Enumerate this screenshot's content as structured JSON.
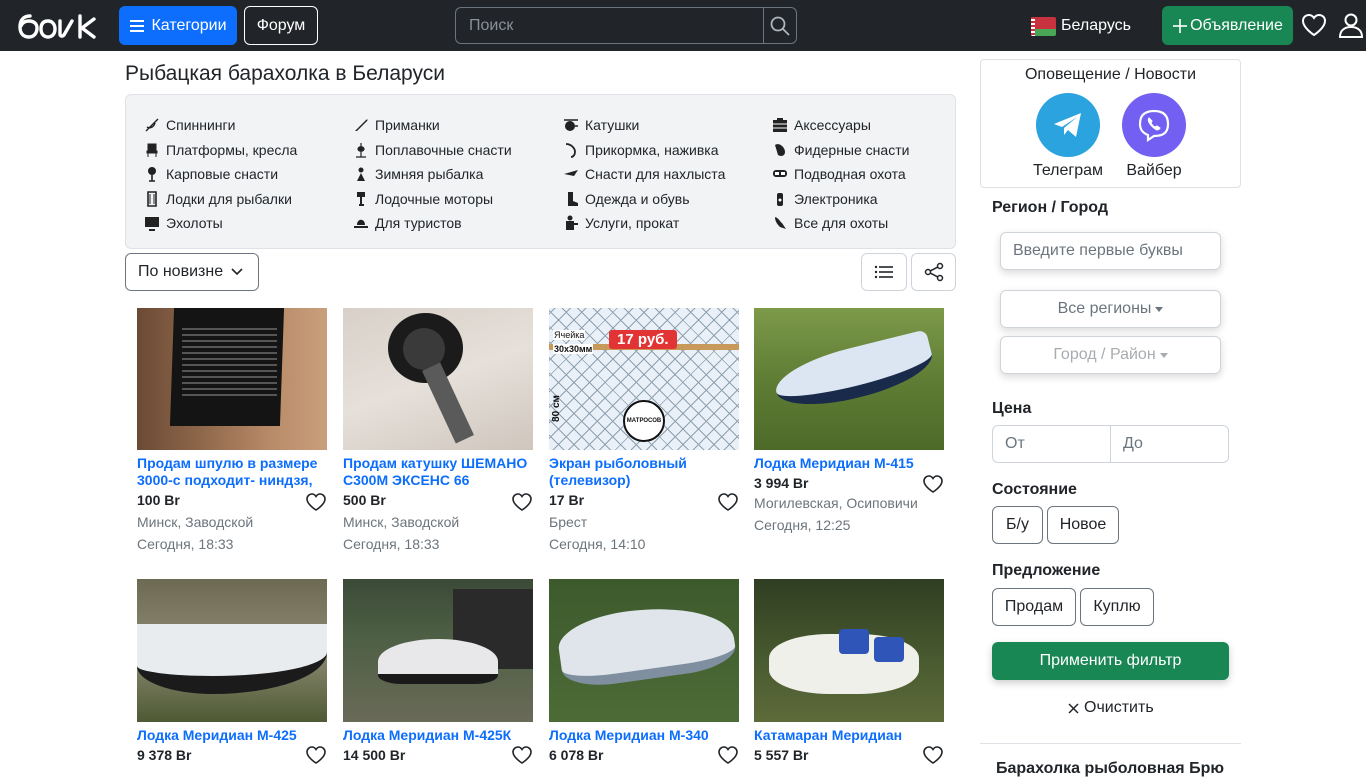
{
  "header": {
    "categories_label": "Категории",
    "forum_label": "Форум",
    "search_placeholder": "Поиск",
    "country": "Беларусь",
    "add_ad_label": "Объявление"
  },
  "page": {
    "title": "Рыбацкая барахолка в Беларуси"
  },
  "categories": [
    [
      "Спиннинги",
      "Платформы, кресла",
      "Карповые снасти",
      "Лодки для рыбалки",
      "Эхолоты"
    ],
    [
      "Приманки",
      "Поплавочные снасти",
      "Зимняя рыбалка",
      "Лодочные моторы",
      "Для туристов"
    ],
    [
      "Катушки",
      "Прикормка, наживка",
      "Снасти для нахлыста",
      "Одежда и обувь",
      "Услуги, прокат"
    ],
    [
      "Аксессуары",
      "Фидерные снасти",
      "Подводная охота",
      "Электроника",
      "Все для охоты"
    ]
  ],
  "toolbar": {
    "sort_label": "По новизне"
  },
  "listings": [
    {
      "title": "Продам шпулю в размере 3000-с подходит- ниндзя,",
      "price": "100 Br",
      "location": "Минск, Заводской",
      "date": "Сегодня, 18:33"
    },
    {
      "title": "Продам катушку ШЕМАНО С300М ЭКСЕНС 66",
      "price": "500 Br",
      "location": "Минск, Заводской",
      "date": "Сегодня, 18:33"
    },
    {
      "title": "Экран рыболовный (телевизор)",
      "price": "17 Br",
      "location": "Брест",
      "date": "Сегодня, 14:10",
      "img_text": {
        "mesh": "Ячейка",
        "size": "30х30мм",
        "price": "17 руб.",
        "height": "80 см",
        "brand": "МАТРОСОВ"
      }
    },
    {
      "title": "Лодка Меридиан М-415",
      "price": "3 994 Br",
      "location": "Могилевская, Осиповичи",
      "date": "Сегодня, 12:25"
    },
    {
      "title": "Лодка Меридиан М-425",
      "price": "9 378 Br"
    },
    {
      "title": "Лодка Меридиан М-425К",
      "price": "14 500 Br"
    },
    {
      "title": "Лодка Меридиан М-340",
      "price": "6 078 Br"
    },
    {
      "title": "Катамаран Меридиан",
      "price": "5 557 Br"
    }
  ],
  "sidebar": {
    "notify_title": "Оповещение / Новости",
    "telegram": "Телеграм",
    "viber": "Вайбер",
    "region_heading": "Регион / Город",
    "region_placeholder": "Введите первые буквы",
    "all_regions": "Все регионы",
    "city_district": "Город / Район",
    "price_heading": "Цена",
    "price_from": "От",
    "price_to": "До",
    "condition_heading": "Состояние",
    "used": "Б/у",
    "new": "Новое",
    "offer_heading": "Предложение",
    "sell": "Продам",
    "buy": "Куплю",
    "apply": "Применить фильтр",
    "clear": "Очистить",
    "bottom_cut": "Барахолка рыболовная Брю"
  },
  "colors": {
    "primary": "#0d6efd",
    "success": "#198754",
    "dark": "#212529",
    "telegram": "#2aa3de",
    "viber": "#7360f2"
  }
}
